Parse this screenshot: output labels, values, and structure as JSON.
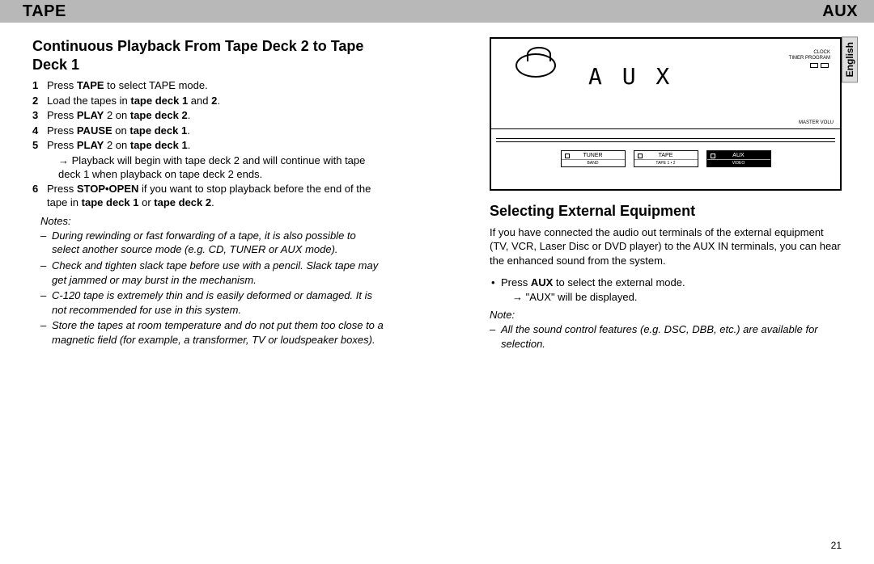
{
  "header": {
    "left": "TAPE",
    "right": "AUX"
  },
  "lang_tab": "English",
  "page_num": "21",
  "tape": {
    "title": "Continuous Playback From Tape Deck 2 to Tape Deck 1",
    "steps": [
      {
        "num": "1",
        "pre": "Press ",
        "bold": "TAPE",
        "post": " to select TAPE mode."
      },
      {
        "num": "2",
        "pre": "Load the tapes in ",
        "bold": "tape deck 1",
        "post": " and ",
        "bold2": "2",
        "post2": "."
      },
      {
        "num": "3",
        "pre": "Press ",
        "bold": "PLAY",
        "mid": " 2  on ",
        "bold2": "tape deck 2",
        "post2": "."
      },
      {
        "num": "4",
        "pre": "Press ",
        "bold": "PAUSE",
        "mid": " on ",
        "bold2": "tape deck 1",
        "post2": "."
      },
      {
        "num": "5",
        "pre": "Press ",
        "bold": "PLAY",
        "mid": " 2  on ",
        "bold2": "tape deck 1",
        "post2": ".",
        "sub": "→ Playback will begin with tape deck 2 and will continue with tape deck 1 when playback on tape deck 2 ends."
      },
      {
        "num": "6",
        "pre": "Press ",
        "bold": "STOP•OPEN",
        "post": " if you want to stop playback before the end of the tape in ",
        "bold2": "tape deck 1",
        "mid2": " or ",
        "bold3": "tape deck 2",
        "post3": "."
      }
    ],
    "notes_title": "Notes:",
    "notes": [
      "During rewinding or fast forwarding of a tape, it is also possible to select another source mode (e.g. CD, TUNER or AUX mode).",
      "Check and tighten slack tape before use with a pencil. Slack tape may get jammed or may burst in the mechanism.",
      "C-120 tape is extremely thin and is easily deformed or damaged. It is not recommended for use in this system.",
      "Store the tapes at room temperature and do not put them too close to a magnetic field (for example, a transformer, TV or loudspeaker boxes)."
    ]
  },
  "illustration": {
    "aux_display": "A U X",
    "clock": "CLOCK",
    "timer": "TIMER  PROGRAM",
    "master_vol": "MASTER VOLU",
    "buttons": [
      {
        "label": "TUNER",
        "sub": "BAND",
        "active": false
      },
      {
        "label": "TAPE",
        "sub": "TAPE 1 • 2",
        "active": false
      },
      {
        "label": "AUX",
        "sub": "VIDEO",
        "active": true
      }
    ]
  },
  "aux": {
    "title": "Selecting External Equipment",
    "intro": "If you have connected the audio out terminals of the external equipment (TV, VCR, Laser Disc or DVD player) to the AUX IN terminals, you can hear the enhanced sound from the system.",
    "bullet_pre": "Press ",
    "bullet_bold": "AUX",
    "bullet_post": " to select the external mode.",
    "bullet_sub": "→ \"AUX\" will be displayed.",
    "note_title": "Note:",
    "note": "All the sound control features (e.g. DSC, DBB, etc.) are available for selection."
  }
}
